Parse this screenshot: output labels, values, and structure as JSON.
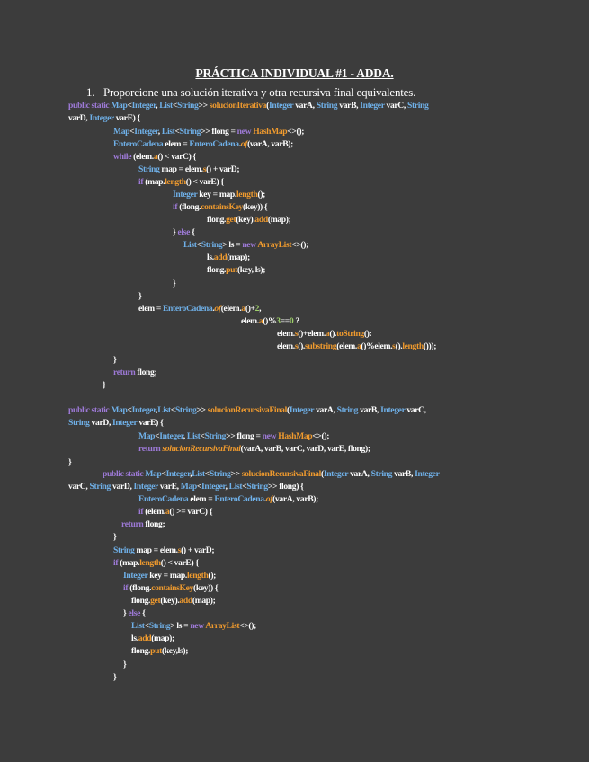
{
  "document": {
    "title": "PRÁCTICA INDIVIDUAL #1 - ADDA.",
    "item_number": "1.",
    "item_text": "Proporcione una solución iterativa y otra recursiva final equivalentes."
  },
  "colors": {
    "background": "#3c3c3c",
    "keyword": "#9e7ad8",
    "type": "#6fb0e8",
    "method": "#ef9a2e",
    "text": "#ffffff",
    "literal": "#9ecf6a"
  },
  "code_lines": [
    [
      [
        "k",
        "public static "
      ],
      [
        "t",
        "Map"
      ],
      [
        "p",
        "<"
      ],
      [
        "t",
        "Integer"
      ],
      [
        "p",
        ", "
      ],
      [
        "t",
        "List"
      ],
      [
        "p",
        "<"
      ],
      [
        "t",
        "String"
      ],
      [
        "p",
        ">> "
      ],
      [
        "m",
        "solucionIterativa"
      ],
      [
        "p",
        "("
      ],
      [
        "t",
        "Integer "
      ],
      [
        "v",
        "varA"
      ],
      [
        "p",
        ", "
      ],
      [
        "t",
        "String "
      ],
      [
        "v",
        "varB"
      ],
      [
        "p",
        ", "
      ],
      [
        "t",
        "Integer "
      ],
      [
        "v",
        "varC"
      ],
      [
        "p",
        ", "
      ],
      [
        "t",
        "String"
      ]
    ],
    [
      [
        "v",
        "varD"
      ],
      [
        "p",
        ", "
      ],
      [
        "t",
        "Integer "
      ],
      [
        "v",
        "varE"
      ],
      [
        "p",
        ") {"
      ]
    ],
    [
      [
        "t",
        "Map"
      ],
      [
        "p",
        "<"
      ],
      [
        "t",
        "Integer"
      ],
      [
        "p",
        ", "
      ],
      [
        "t",
        "List"
      ],
      [
        "p",
        "<"
      ],
      [
        "t",
        "String"
      ],
      [
        "p",
        ">> "
      ],
      [
        "v",
        "flong"
      ],
      [
        "p",
        " = "
      ],
      [
        "k",
        "new "
      ],
      [
        "m",
        "HashMap"
      ],
      [
        "p",
        "<>();"
      ]
    ],
    [
      [
        "t",
        "EnteroCadena "
      ],
      [
        "v",
        "elem"
      ],
      [
        "p",
        " = "
      ],
      [
        "t",
        "EnteroCadena"
      ],
      [
        "p",
        "."
      ],
      [
        "i",
        "of"
      ],
      [
        "p",
        "("
      ],
      [
        "v",
        "varA"
      ],
      [
        "p",
        ", "
      ],
      [
        "v",
        "varB"
      ],
      [
        "p",
        ");"
      ]
    ],
    [
      [
        "k",
        "while "
      ],
      [
        "p",
        "("
      ],
      [
        "v",
        "elem"
      ],
      [
        "p",
        "."
      ],
      [
        "m",
        "a"
      ],
      [
        "p",
        "() < "
      ],
      [
        "v",
        "varC"
      ],
      [
        "p",
        ") {"
      ]
    ],
    [
      [
        "t",
        "String "
      ],
      [
        "v",
        "map"
      ],
      [
        "p",
        " = "
      ],
      [
        "v",
        "elem"
      ],
      [
        "p",
        "."
      ],
      [
        "m",
        "s"
      ],
      [
        "p",
        "() + "
      ],
      [
        "v",
        "varD"
      ],
      [
        "p",
        ";"
      ]
    ],
    [
      [
        "k",
        "if "
      ],
      [
        "p",
        "("
      ],
      [
        "v",
        "map"
      ],
      [
        "p",
        "."
      ],
      [
        "m",
        "length"
      ],
      [
        "p",
        "() < "
      ],
      [
        "v",
        "varE"
      ],
      [
        "p",
        ") {"
      ]
    ],
    [
      [
        "t",
        "Integer "
      ],
      [
        "v",
        "key"
      ],
      [
        "p",
        " = "
      ],
      [
        "v",
        "map"
      ],
      [
        "p",
        "."
      ],
      [
        "m",
        "length"
      ],
      [
        "p",
        "();"
      ]
    ],
    [
      [
        "k",
        "if "
      ],
      [
        "p",
        "("
      ],
      [
        "v",
        "flong"
      ],
      [
        "p",
        "."
      ],
      [
        "m",
        "containsKey"
      ],
      [
        "p",
        "("
      ],
      [
        "v",
        "key"
      ],
      [
        "p",
        ")) {"
      ]
    ],
    [
      [
        "v",
        "flong"
      ],
      [
        "p",
        "."
      ],
      [
        "m",
        "get"
      ],
      [
        "p",
        "("
      ],
      [
        "v",
        "key"
      ],
      [
        "p",
        ")."
      ],
      [
        "m",
        "add"
      ],
      [
        "p",
        "("
      ],
      [
        "v",
        "map"
      ],
      [
        "p",
        ");"
      ]
    ],
    [
      [
        "p",
        "} "
      ],
      [
        "k",
        "else "
      ],
      [
        "p",
        "{"
      ]
    ],
    [
      [
        "t",
        "List"
      ],
      [
        "p",
        "<"
      ],
      [
        "t",
        "String"
      ],
      [
        "p",
        "> "
      ],
      [
        "v",
        "ls"
      ],
      [
        "p",
        " = "
      ],
      [
        "k",
        "new "
      ],
      [
        "m",
        "ArrayList"
      ],
      [
        "p",
        "<>();"
      ]
    ],
    [
      [
        "v",
        "ls"
      ],
      [
        "p",
        "."
      ],
      [
        "m",
        "add"
      ],
      [
        "p",
        "("
      ],
      [
        "v",
        "map"
      ],
      [
        "p",
        ");"
      ]
    ],
    [
      [
        "v",
        "flong"
      ],
      [
        "p",
        "."
      ],
      [
        "m",
        "put"
      ],
      [
        "p",
        "("
      ],
      [
        "v",
        "key"
      ],
      [
        "p",
        ", "
      ],
      [
        "v",
        "ls"
      ],
      [
        "p",
        ");"
      ]
    ],
    [
      [
        "p",
        "}"
      ]
    ],
    [
      [
        "p",
        "}"
      ]
    ],
    [
      [
        "v",
        "elem"
      ],
      [
        "p",
        " = "
      ],
      [
        "t",
        "EnteroCadena"
      ],
      [
        "p",
        "."
      ],
      [
        "i",
        "of"
      ],
      [
        "p",
        "("
      ],
      [
        "v",
        "elem"
      ],
      [
        "p",
        "."
      ],
      [
        "m",
        "a"
      ],
      [
        "p",
        "()+"
      ],
      [
        "n",
        "2"
      ],
      [
        "p",
        ","
      ]
    ],
    [
      [
        "v",
        "elem"
      ],
      [
        "p",
        "."
      ],
      [
        "m",
        "a"
      ],
      [
        "p",
        "()%"
      ],
      [
        "n",
        "3"
      ],
      [
        "p",
        "=="
      ],
      [
        "n",
        "0"
      ],
      [
        "p",
        " ?"
      ]
    ],
    [
      [
        "v",
        "elem"
      ],
      [
        "p",
        "."
      ],
      [
        "m",
        "s"
      ],
      [
        "p",
        "()+"
      ],
      [
        "v",
        "elem"
      ],
      [
        "p",
        "."
      ],
      [
        "m",
        "a"
      ],
      [
        "p",
        "()."
      ],
      [
        "m",
        "toString"
      ],
      [
        "p",
        "():"
      ]
    ],
    [
      [
        "v",
        "elem"
      ],
      [
        "p",
        "."
      ],
      [
        "m",
        "s"
      ],
      [
        "p",
        "()."
      ],
      [
        "m",
        "substring"
      ],
      [
        "p",
        "("
      ],
      [
        "v",
        "elem"
      ],
      [
        "p",
        "."
      ],
      [
        "m",
        "a"
      ],
      [
        "p",
        "()%"
      ],
      [
        "v",
        "elem"
      ],
      [
        "p",
        "."
      ],
      [
        "m",
        "s"
      ],
      [
        "p",
        "()."
      ],
      [
        "m",
        "length"
      ],
      [
        "p",
        "()));"
      ]
    ],
    [
      [
        "p",
        "}"
      ]
    ],
    [
      [
        "k",
        "return "
      ],
      [
        "v",
        "flong"
      ],
      [
        "p",
        ";"
      ]
    ],
    [
      [
        "p",
        "}"
      ]
    ],
    [
      [
        "k",
        "public static "
      ],
      [
        "t",
        "Map"
      ],
      [
        "p",
        "<"
      ],
      [
        "t",
        "Integer"
      ],
      [
        "p",
        ","
      ],
      [
        "t",
        "List"
      ],
      [
        "p",
        "<"
      ],
      [
        "t",
        "String"
      ],
      [
        "p",
        ">> "
      ],
      [
        "m",
        "solucionRecursivaFinal"
      ],
      [
        "p",
        "("
      ],
      [
        "t",
        "Integer "
      ],
      [
        "v",
        "varA"
      ],
      [
        "p",
        ", "
      ],
      [
        "t",
        "String "
      ],
      [
        "v",
        "varB"
      ],
      [
        "p",
        ", "
      ],
      [
        "t",
        "Integer "
      ],
      [
        "v",
        "varC"
      ],
      [
        "p",
        ","
      ]
    ],
    [
      [
        "t",
        "String "
      ],
      [
        "v",
        "varD"
      ],
      [
        "p",
        ", "
      ],
      [
        "t",
        "Integer "
      ],
      [
        "v",
        "varE"
      ],
      [
        "p",
        ") {"
      ]
    ],
    [
      [
        "t",
        "Map"
      ],
      [
        "p",
        "<"
      ],
      [
        "t",
        "Integer"
      ],
      [
        "p",
        ", "
      ],
      [
        "t",
        "List"
      ],
      [
        "p",
        "<"
      ],
      [
        "t",
        "String"
      ],
      [
        "p",
        ">> "
      ],
      [
        "v",
        "flong"
      ],
      [
        "p",
        " = "
      ],
      [
        "k",
        "new "
      ],
      [
        "m",
        "HashMap"
      ],
      [
        "p",
        "<>();"
      ]
    ],
    [
      [
        "k",
        "return "
      ],
      [
        "i",
        "solucionRecursivaFinal"
      ],
      [
        "p",
        "("
      ],
      [
        "v",
        "varA"
      ],
      [
        "p",
        ", "
      ],
      [
        "v",
        "varB"
      ],
      [
        "p",
        ", "
      ],
      [
        "v",
        "varC"
      ],
      [
        "p",
        ", "
      ],
      [
        "v",
        "varD"
      ],
      [
        "p",
        ", "
      ],
      [
        "v",
        "varE"
      ],
      [
        "p",
        ", "
      ],
      [
        "v",
        "flong"
      ],
      [
        "p",
        ");"
      ]
    ],
    [
      [
        "p",
        "}"
      ]
    ],
    [
      [
        "k",
        "public static "
      ],
      [
        "t",
        "Map"
      ],
      [
        "p",
        "<"
      ],
      [
        "t",
        "Integer"
      ],
      [
        "p",
        ","
      ],
      [
        "t",
        "List"
      ],
      [
        "p",
        "<"
      ],
      [
        "t",
        "String"
      ],
      [
        "p",
        ">> "
      ],
      [
        "m",
        "solucionRecursivaFinal"
      ],
      [
        "p",
        "("
      ],
      [
        "t",
        "Integer "
      ],
      [
        "v",
        "varA"
      ],
      [
        "p",
        ", "
      ],
      [
        "t",
        "String "
      ],
      [
        "v",
        "varB"
      ],
      [
        "p",
        ", "
      ],
      [
        "t",
        "Integer"
      ]
    ],
    [
      [
        "v",
        "varC"
      ],
      [
        "p",
        ", "
      ],
      [
        "t",
        "String "
      ],
      [
        "v",
        "varD"
      ],
      [
        "p",
        ", "
      ],
      [
        "t",
        "Integer "
      ],
      [
        "v",
        "varE"
      ],
      [
        "p",
        ", "
      ],
      [
        "t",
        "Map"
      ],
      [
        "p",
        "<"
      ],
      [
        "t",
        "Integer"
      ],
      [
        "p",
        ", "
      ],
      [
        "t",
        "List"
      ],
      [
        "p",
        "<"
      ],
      [
        "t",
        "String"
      ],
      [
        "p",
        ">> "
      ],
      [
        "v",
        "flong"
      ],
      [
        "p",
        ") {"
      ]
    ],
    [
      [
        "t",
        "EnteroCadena "
      ],
      [
        "v",
        "elem"
      ],
      [
        "p",
        " = "
      ],
      [
        "t",
        "EnteroCadena"
      ],
      [
        "p",
        "."
      ],
      [
        "i",
        "of"
      ],
      [
        "p",
        "("
      ],
      [
        "v",
        "varA"
      ],
      [
        "p",
        ", "
      ],
      [
        "v",
        "varB"
      ],
      [
        "p",
        ");"
      ]
    ],
    [
      [
        "k",
        "if "
      ],
      [
        "p",
        "("
      ],
      [
        "v",
        "elem"
      ],
      [
        "p",
        "."
      ],
      [
        "m",
        "a"
      ],
      [
        "p",
        "() >= "
      ],
      [
        "v",
        "varC"
      ],
      [
        "p",
        ") {"
      ]
    ],
    [
      [
        "k",
        "return "
      ],
      [
        "v",
        "flong"
      ],
      [
        "p",
        ";"
      ]
    ],
    [
      [
        "p",
        "}"
      ]
    ],
    [
      [
        "t",
        "String "
      ],
      [
        "v",
        "map"
      ],
      [
        "p",
        " = "
      ],
      [
        "v",
        "elem"
      ],
      [
        "p",
        "."
      ],
      [
        "m",
        "s"
      ],
      [
        "p",
        "() + "
      ],
      [
        "v",
        "varD"
      ],
      [
        "p",
        ";"
      ]
    ],
    [
      [
        "k",
        "if "
      ],
      [
        "p",
        "("
      ],
      [
        "v",
        "map"
      ],
      [
        "p",
        "."
      ],
      [
        "m",
        "length"
      ],
      [
        "p",
        "() < "
      ],
      [
        "v",
        "varE"
      ],
      [
        "p",
        ") {"
      ]
    ],
    [
      [
        "t",
        "Integer "
      ],
      [
        "v",
        "key"
      ],
      [
        "p",
        " = "
      ],
      [
        "v",
        "map"
      ],
      [
        "p",
        "."
      ],
      [
        "m",
        "length"
      ],
      [
        "p",
        "();"
      ]
    ],
    [
      [
        "k",
        "if "
      ],
      [
        "p",
        "("
      ],
      [
        "v",
        "flong"
      ],
      [
        "p",
        "."
      ],
      [
        "m",
        "containsKey"
      ],
      [
        "p",
        "("
      ],
      [
        "v",
        "key"
      ],
      [
        "p",
        ")) {"
      ]
    ],
    [
      [
        "v",
        "flong"
      ],
      [
        "p",
        "."
      ],
      [
        "m",
        "get"
      ],
      [
        "p",
        "("
      ],
      [
        "v",
        "key"
      ],
      [
        "p",
        ")."
      ],
      [
        "m",
        "add"
      ],
      [
        "p",
        "("
      ],
      [
        "v",
        "map"
      ],
      [
        "p",
        ");"
      ]
    ],
    [
      [
        "p",
        "} "
      ],
      [
        "k",
        "else "
      ],
      [
        "p",
        "{"
      ]
    ],
    [
      [
        "t",
        "List"
      ],
      [
        "p",
        "<"
      ],
      [
        "t",
        "String"
      ],
      [
        "p",
        "> "
      ],
      [
        "v",
        "ls"
      ],
      [
        "p",
        " = "
      ],
      [
        "k",
        "new "
      ],
      [
        "m",
        "ArrayList"
      ],
      [
        "p",
        "<>();"
      ]
    ],
    [
      [
        "v",
        "ls"
      ],
      [
        "p",
        "."
      ],
      [
        "m",
        "add"
      ],
      [
        "p",
        "("
      ],
      [
        "v",
        "map"
      ],
      [
        "p",
        ");"
      ]
    ],
    [
      [
        "v",
        "flong"
      ],
      [
        "p",
        "."
      ],
      [
        "m",
        "put"
      ],
      [
        "p",
        "("
      ],
      [
        "v",
        "key"
      ],
      [
        "p",
        ","
      ],
      [
        "v",
        "ls"
      ],
      [
        "p",
        ");"
      ]
    ],
    [
      [
        "p",
        "}"
      ]
    ],
    [
      [
        "p",
        "}"
      ]
    ]
  ]
}
